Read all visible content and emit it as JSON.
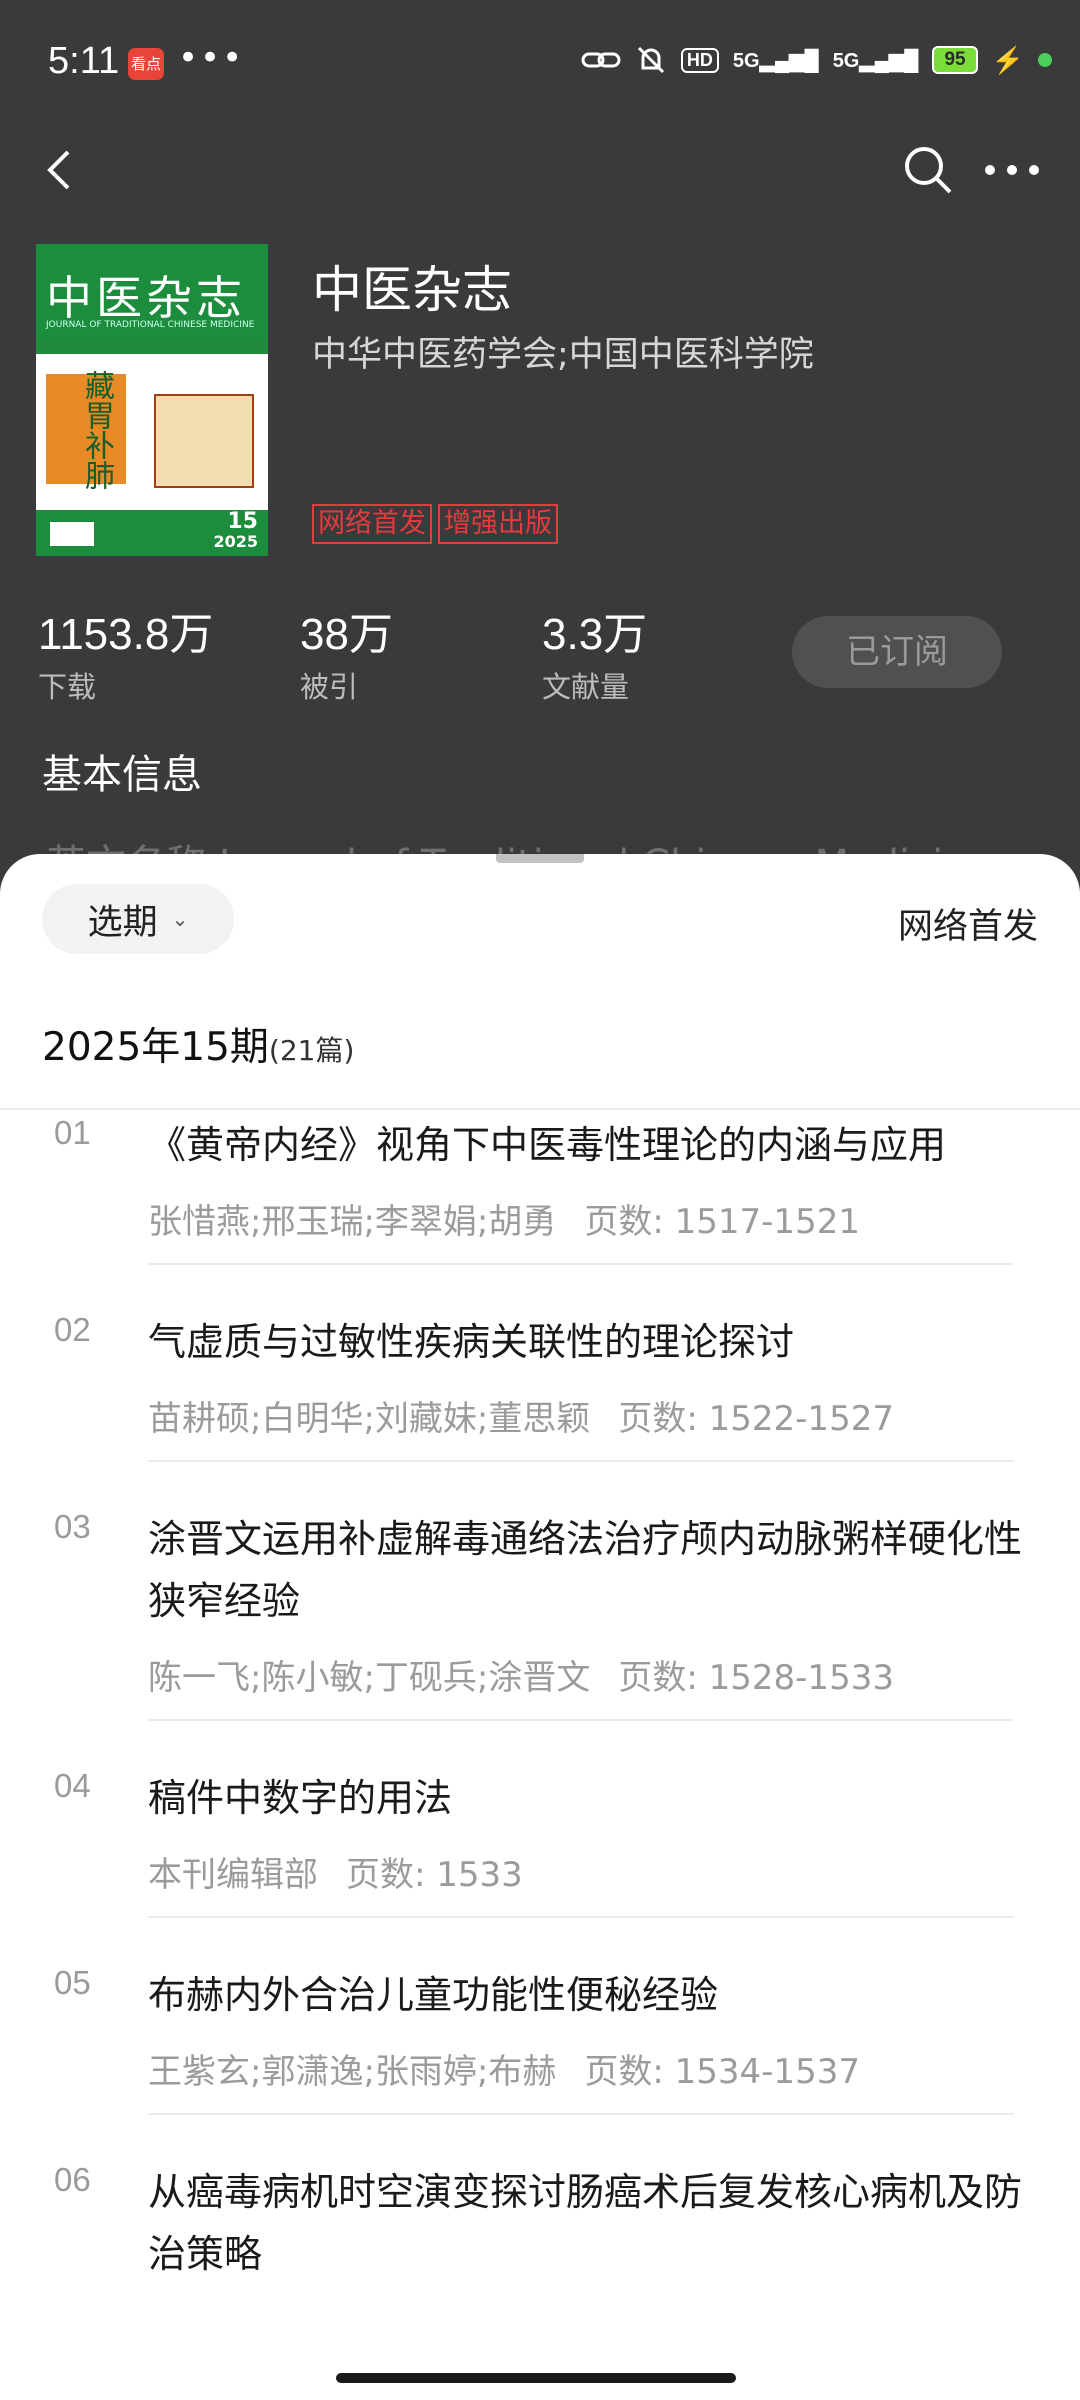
{
  "status_bar": {
    "time": "5:11",
    "app_badge": "看点",
    "more_dots": "•••",
    "hd": "HD",
    "signal1": "5G",
    "signal2": "5G",
    "battery": "95"
  },
  "journal": {
    "title": "中医杂志",
    "publisher": "中华中医药学会;中国中医科学院",
    "tags": [
      "网络首发",
      "增强出版"
    ],
    "cover": {
      "title": "中医杂志",
      "subtitle": "JOURNAL OF TRADITIONAL CHINESE MEDICINE",
      "feature": "藏胃补肺",
      "issue": "15",
      "year": "2025"
    }
  },
  "stats": [
    {
      "value": "1153.8万",
      "label": "下载"
    },
    {
      "value": "38万",
      "label": "被引"
    },
    {
      "value": "3.3万",
      "label": "文献量"
    }
  ],
  "subscribe_label": "已订阅",
  "basic_info": {
    "heading": "基本信息",
    "peek": "英文名称    Journal of Traditional Chinese Medicine"
  },
  "sheet": {
    "select_label": "选期",
    "online_first": "网络首发",
    "issue": "2025年15期",
    "count": "(21篇)"
  },
  "articles": [
    {
      "num": "01",
      "title": "《黄帝内经》视角下中医毒性理论的内涵与应用",
      "authors": "张惜燕;邢玉瑞;李翠娟;胡勇",
      "pages": "页数: 1517-1521"
    },
    {
      "num": "02",
      "title": "气虚质与过敏性疾病关联性的理论探讨",
      "authors": "苗耕硕;白明华;刘藏妹;董思颖",
      "pages": "页数: 1522-1527"
    },
    {
      "num": "03",
      "title": "涂晋文运用补虚解毒通络法治疗颅内动脉粥样硬化性狭窄经验",
      "authors": "陈一飞;陈小敏;丁砚兵;涂晋文",
      "pages": "页数: 1528-1533"
    },
    {
      "num": "04",
      "title": "稿件中数字的用法",
      "authors": "本刊编辑部",
      "pages": "页数: 1533"
    },
    {
      "num": "05",
      "title": "布赫内外合治儿童功能性便秘经验",
      "authors": "王紫玄;郭潇逸;张雨婷;布赫",
      "pages": "页数: 1534-1537"
    },
    {
      "num": "06",
      "title": "从癌毒病机时空演变探讨肠癌术后复发核心病机及防治策略",
      "authors": "",
      "pages": ""
    }
  ]
}
